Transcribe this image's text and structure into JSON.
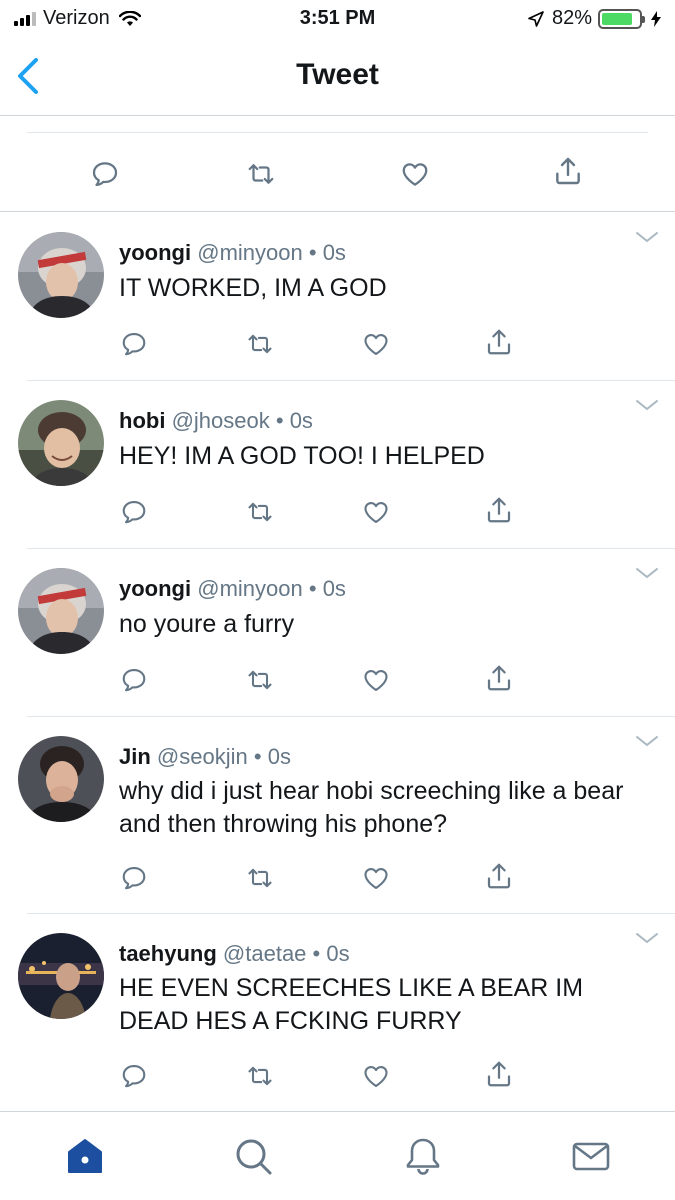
{
  "status_bar": {
    "carrier": "Verizon",
    "time": "3:51 PM",
    "battery_percent": "82%",
    "battery_level": 0.82
  },
  "nav": {
    "title": "Tweet"
  },
  "colors": {
    "accent": "#1da1f2",
    "tab_active": "#1c4fa0",
    "icon_gray": "#657786",
    "battery_green": "#4cd964"
  },
  "replies": [
    {
      "name": "yoongi",
      "handle": "@minyoon",
      "separator": "•",
      "time": "0s",
      "text": "IT WORKED, IM A GOD",
      "avatar": "avatar-yoongi"
    },
    {
      "name": "hobi",
      "handle": "@jhoseok",
      "separator": "•",
      "time": "0s",
      "text": "HEY! IM A GOD TOO! I HELPED",
      "avatar": "avatar-hobi"
    },
    {
      "name": "yoongi",
      "handle": "@minyoon",
      "separator": "•",
      "time": "0s",
      "text": "no youre a furry",
      "avatar": "avatar-yoongi"
    },
    {
      "name": "Jin",
      "handle": "@seokjin",
      "separator": "•",
      "time": "0s",
      "text": "why did i just hear hobi screeching like a bear and then throwing his phone?",
      "avatar": "avatar-jin"
    },
    {
      "name": "taehyung",
      "handle": "@taetae",
      "separator": "•",
      "time": "0s",
      "text": "HE EVEN SCREECHES LIKE A BEAR IM DEAD HES A FCKING FURRY",
      "avatar": "avatar-taehyung"
    }
  ],
  "tabbar": {
    "items": [
      "home-icon",
      "search-icon",
      "bell-icon",
      "mail-icon"
    ],
    "active": "home-icon"
  }
}
